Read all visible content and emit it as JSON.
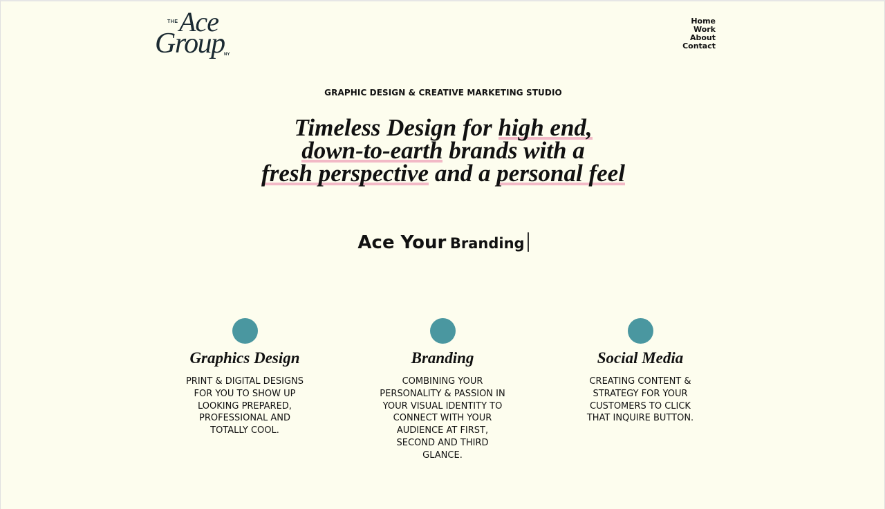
{
  "logo": {
    "the": "THE",
    "ace": "Ace",
    "group": "Group",
    "ny": "NY"
  },
  "nav": {
    "items": [
      "Home",
      "Work",
      "About",
      "Contact"
    ]
  },
  "tagline": "GRAPHIC DESIGN & CREATIVE MARKETING STUDIO",
  "headline": {
    "line1_a": "Timeless Design for ",
    "line1_hl": "high end,",
    "line2_hl": "down-to-earth",
    "line2_b": " brands with a",
    "line3_hl1": "fresh perspective",
    "line3_b": " and a ",
    "line3_hl2": "personal feel"
  },
  "typed": {
    "prefix": "Ace Your",
    "word": "Branding"
  },
  "services": [
    {
      "title": "Graphics Design",
      "description": "PRINT & DIGITAL DESIGNS FOR YOU TO SHOW UP LOOKING PREPARED, PROFESSIONAL AND TOTALLY COOL."
    },
    {
      "title": "Branding",
      "description": "COMBINING YOUR PERSONALITY & PASSION IN YOUR VISUAL IDENTITY TO CONNECT WITH YOUR AUDIENCE AT FIRST, SECOND AND THIRD GLANCE."
    },
    {
      "title": "Social Media",
      "description": "CREATING CONTENT & STRATEGY FOR YOUR CUSTOMERS TO CLICK THAT INQUIRE BUTTON."
    }
  ],
  "colors": {
    "background": "#fdfdee",
    "accent_teal": "#4a97a0",
    "highlight_pink": "#f2b9c6",
    "logo_navy": "#1b2a32"
  }
}
